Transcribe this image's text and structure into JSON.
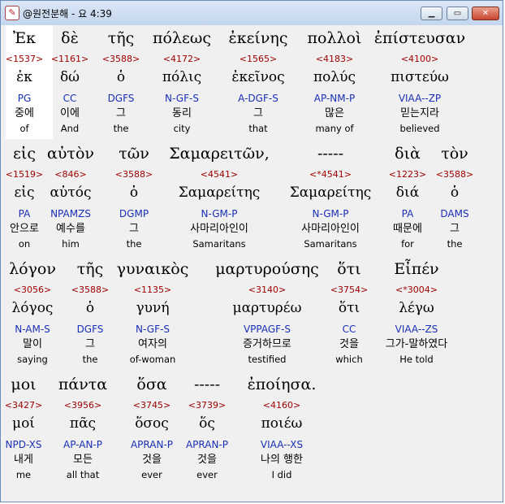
{
  "window": {
    "title": "@원전분해 - 요 4:39",
    "app_icon_glyph": "✎",
    "min_glyph": "▁",
    "max_glyph": "▭",
    "close_glyph": "✕"
  },
  "rows": [
    [
      {
        "greek": "Ἐκ",
        "num": "<1537>",
        "lemma": "ἐκ",
        "parsing": "PG",
        "korean": "중에",
        "english": "of"
      },
      {
        "greek": "δὲ",
        "num": "<1161>",
        "lemma": "δώ",
        "parsing": "CC",
        "korean": "이에",
        "english": "And"
      },
      {
        "greek": "τῆς",
        "num": "<3588>",
        "lemma": "ὁ",
        "parsing": "DGFS",
        "korean": "그",
        "english": "the"
      },
      {
        "greek": "πόλεως",
        "num": "<4172>",
        "lemma": "πόλις",
        "parsing": "N-GF-S",
        "korean": "동리",
        "english": "city"
      },
      {
        "greek": "ἐκείνης",
        "num": "<1565>",
        "lemma": "ἐκεῖνος",
        "parsing": "A-DGF-S",
        "korean": "그",
        "english": "that"
      },
      {
        "greek": "πολλοὶ",
        "num": "<4183>",
        "lemma": "πολύς",
        "parsing": "AP-NM-P",
        "korean": "많은",
        "english": "many of"
      },
      {
        "greek": "ἐπίστευσαν",
        "num": "<4100>",
        "lemma": "πιστεύω",
        "parsing": "VIAA--ZP",
        "korean": "믿는지라",
        "english": "believed"
      }
    ],
    [
      {
        "greek": "εἰς",
        "num": "<1519>",
        "lemma": "εἰς",
        "parsing": "PA",
        "korean": "안으로",
        "english": "on"
      },
      {
        "greek": "αὐτὸν",
        "num": "<846>",
        "lemma": "αὐτός",
        "parsing": "NPAMZS",
        "korean": "예수를",
        "english": "him"
      },
      {
        "greek": "τῶν",
        "num": "<3588>",
        "lemma": "ὁ",
        "parsing": "DGMP",
        "korean": "그",
        "english": "the"
      },
      {
        "greek": "Σαμαρειτῶν,",
        "num": "<4541>",
        "lemma": "Σαμαρείτης",
        "parsing": "N-GM-P",
        "korean": "사마리아인이",
        "english": "Samaritans"
      },
      {
        "greek": "-----",
        "num": "<*4541>",
        "lemma": "Σαμαρείτης",
        "parsing": "N-GM-P",
        "korean": "사마리아인이",
        "english": "Samaritans"
      },
      {
        "greek": "διὰ",
        "num": "<1223>",
        "lemma": "διά",
        "parsing": "PA",
        "korean": "때문에",
        "english": "for"
      },
      {
        "greek": "τὸν",
        "num": "<3588>",
        "lemma": "ὁ",
        "parsing": "DAMS",
        "korean": "그",
        "english": "the"
      }
    ],
    [
      {
        "greek": "λόγον",
        "num": "<3056>",
        "lemma": "λόγος",
        "parsing": "N-AM-S",
        "korean": "말이",
        "english": "saying"
      },
      {
        "greek": "τῆς",
        "num": "<3588>",
        "lemma": "ὁ",
        "parsing": "DGFS",
        "korean": "그",
        "english": "the"
      },
      {
        "greek": "γυναικὸς",
        "num": "<1135>",
        "lemma": "γυνή",
        "parsing": "N-GF-S",
        "korean": "여자의",
        "english": "of-woman"
      },
      {
        "greek": "μαρτυρούσης",
        "num": "<3140>",
        "lemma": "μαρτυρέω",
        "parsing": "VPPAGF-S",
        "korean": "증거하므로",
        "english": "testified"
      },
      {
        "greek": "ὅτι",
        "num": "<3754>",
        "lemma": "ὅτι",
        "parsing": "CC",
        "korean": "것을",
        "english": "which"
      },
      {
        "greek": "Εἶπέν",
        "num": "<*3004>",
        "lemma": "λέγω",
        "parsing": "VIAA--ZS",
        "korean": "그가-말하였다",
        "english": "He told"
      }
    ],
    [
      {
        "greek": "μοι",
        "num": "<3427>",
        "lemma": "μοί",
        "parsing": "NPD-XS",
        "korean": "내게",
        "english": "me"
      },
      {
        "greek": "πάντα",
        "num": "<3956>",
        "lemma": "πᾶς",
        "parsing": "AP-AN-P",
        "korean": "모든",
        "english": "all that"
      },
      {
        "greek": "ὅσα",
        "num": "<3745>",
        "lemma": "ὅσος",
        "parsing": "APRAN-P",
        "korean": "것을",
        "english": "ever"
      },
      {
        "greek": "-----",
        "num": "<3739>",
        "lemma": "ὅς",
        "parsing": "APRAN-P",
        "korean": "것을",
        "english": "ever"
      },
      {
        "greek": "ἐποίησα.",
        "num": "<4160>",
        "lemma": "ποιέω",
        "parsing": "VIAA--XS",
        "korean": "나의 행한",
        "english": "I did"
      }
    ]
  ]
}
